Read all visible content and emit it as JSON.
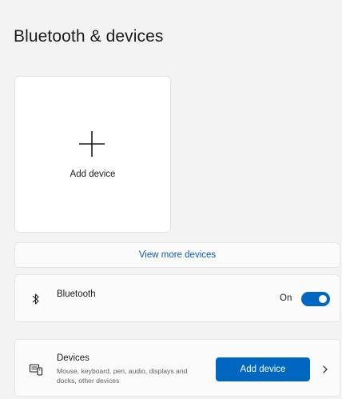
{
  "header": {
    "title": "Bluetooth & devices"
  },
  "add_card": {
    "icon": "plus-icon",
    "label": "Add device"
  },
  "view_more": {
    "label": "View more devices"
  },
  "bluetooth": {
    "icon": "bluetooth-icon",
    "title": "Bluetooth",
    "toggle_label": "On",
    "toggle_state": true
  },
  "devices": {
    "icon": "devices-icon",
    "title": "Devices",
    "subtitle": "Mouse, keyboard, pen, audio, displays and docks, other devices",
    "button_label": "Add device",
    "chevron": "chevron-right-icon"
  },
  "colors": {
    "accent": "#0067c0",
    "link": "#0a59b5",
    "background": "#f3f3f3",
    "card": "#fbfbfb"
  }
}
